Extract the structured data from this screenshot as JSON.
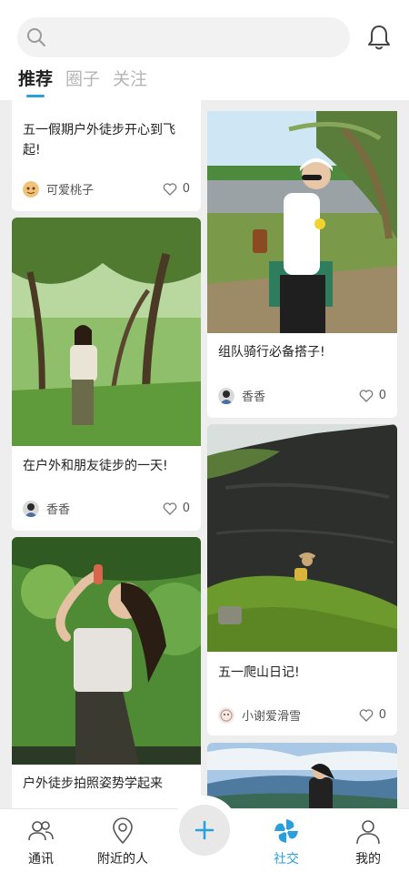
{
  "header": {
    "search_placeholder": "",
    "tabs": [
      {
        "label": "推荐"
      },
      {
        "label": "圈子"
      },
      {
        "label": "关注"
      }
    ]
  },
  "feed": {
    "cards": [
      {
        "title": "五一假期户外徒步开心到飞起!",
        "author": "可爱桃子",
        "likes": "0"
      },
      {
        "title": "组队骑行必备搭子!",
        "author": "香香",
        "likes": "0"
      },
      {
        "title": "在户外和朋友徒步的一天!",
        "author": "香香",
        "likes": "0"
      },
      {
        "title": "五一爬山日记!",
        "author": "小谢爱滑雪",
        "likes": "0"
      },
      {
        "title": "户外徒步拍照姿势学起来",
        "author": "",
        "likes": ""
      }
    ]
  },
  "bottom_nav": {
    "items": [
      {
        "label": "通讯"
      },
      {
        "label": "附近的人"
      },
      {
        "label": "社交"
      },
      {
        "label": "我的"
      }
    ]
  },
  "colors": {
    "accent": "#2a9fe0",
    "feed_background": "#eeeeee"
  }
}
